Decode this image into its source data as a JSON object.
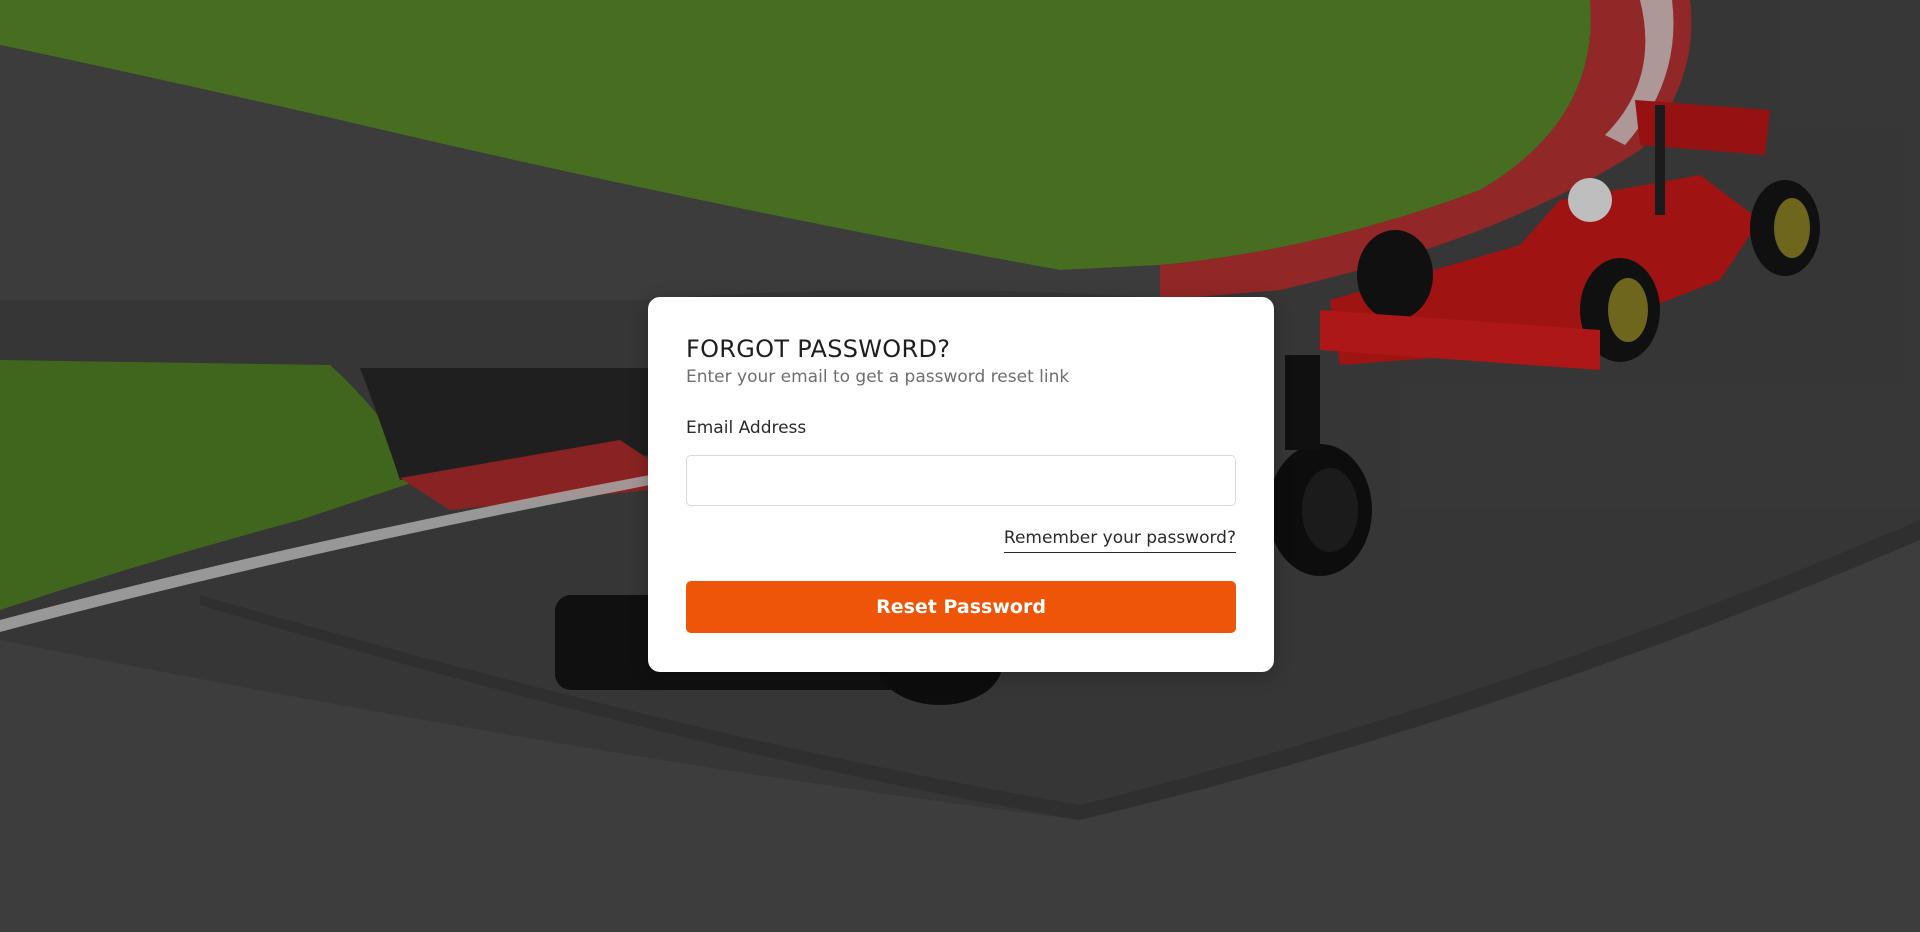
{
  "page": {
    "background_image": "race-track-f1-cars"
  },
  "form": {
    "title": "FORGOT PASSWORD?",
    "subtitle": "Enter your email to get a password reset link",
    "email_label": "Email Address",
    "email_value": "",
    "email_placeholder": "",
    "remember_link": "Remember your password?",
    "submit_label": "Reset Password"
  },
  "colors": {
    "accent": "#ee5509",
    "card_bg": "#ffffff"
  }
}
